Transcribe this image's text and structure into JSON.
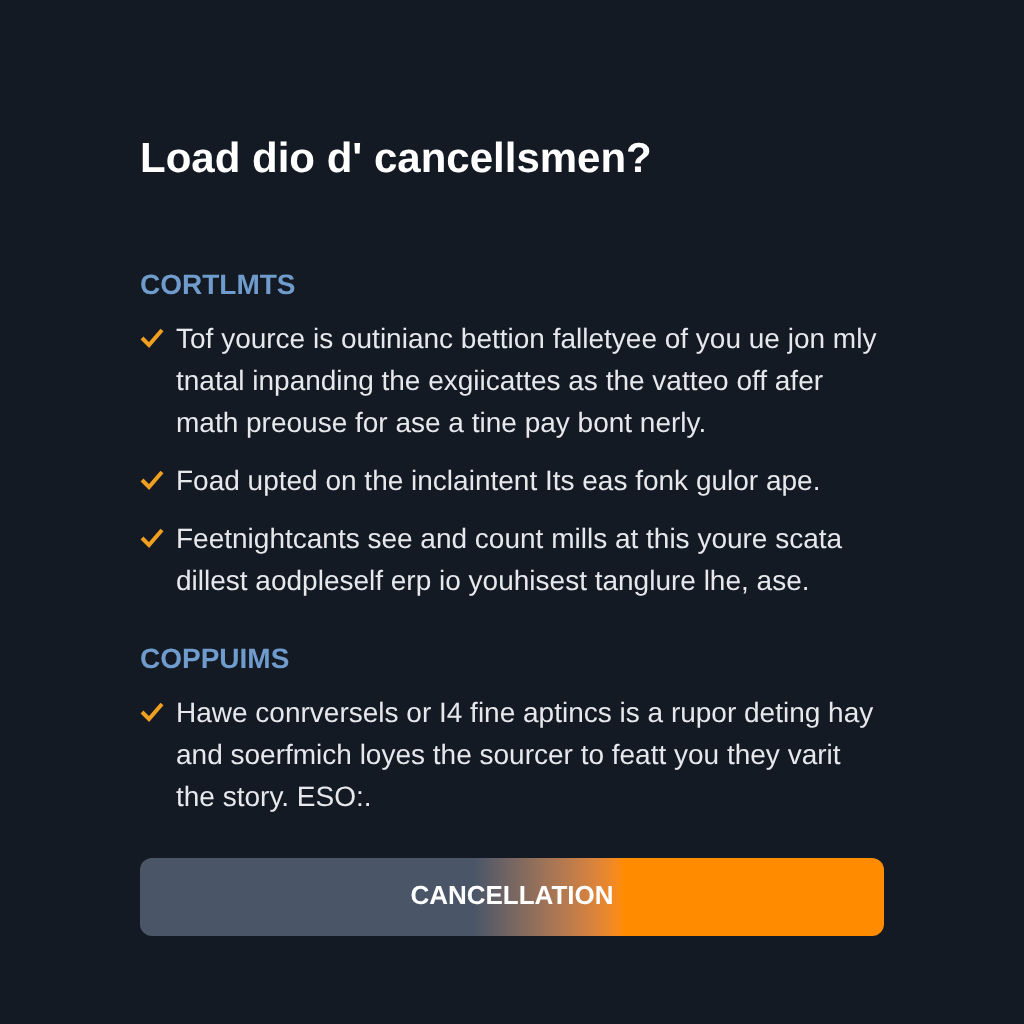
{
  "title": "Load dio d' cancellsmen?",
  "sections": [
    {
      "heading": "CORTLMTS",
      "items": [
        "Tof yource is outinianc bettion falletyee of you ue jon mly tnatal inpanding the exgiicattes as the vatteo off afer math preouse for ase a tine pay bont nerly.",
        "Foad upted on the inclaintent Its eas fonk gulor ape.",
        "Feetnightcants see and count mills at this youre scata dillest aodpleself erp io youhisest tanglure lhe, ase."
      ]
    },
    {
      "heading": "COPPUIMS",
      "items": [
        "Hawe conrversels or I4 fine aptincs is a rupor deting hay and soerfmich loyes the sourcer to featt you they varit the story. ESO:."
      ]
    }
  ],
  "button": "CANCELLATION"
}
